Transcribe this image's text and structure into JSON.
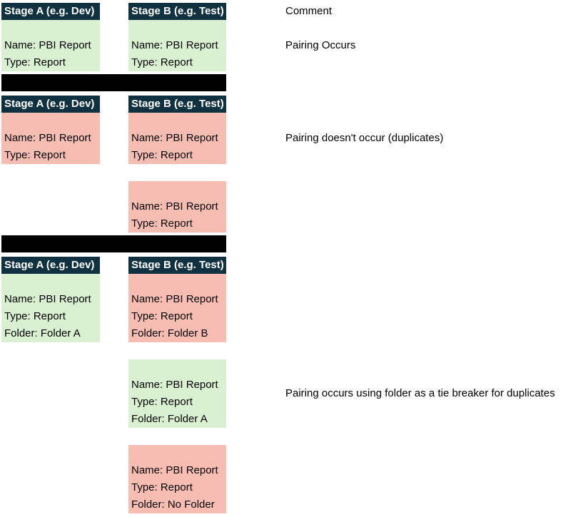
{
  "comment_header": "Comment",
  "colors": {
    "header_bg": "#0f3140",
    "paired": "#d9f1d0",
    "unpaired": "#f8bdb2",
    "separator": "#000000"
  },
  "scenarios": [
    {
      "stage_a_header": "Stage A (e.g. Dev)",
      "stage_b_header": "Stage B (e.g. Test)",
      "stage_a_items": [
        {
          "status": "paired",
          "lines": [
            "Name: PBI Report",
            "Type: Report"
          ]
        }
      ],
      "stage_b_items": [
        {
          "status": "paired",
          "lines": [
            "Name: PBI Report",
            "Type: Report"
          ]
        }
      ],
      "comment": "Pairing Occurs"
    },
    {
      "stage_a_header": "Stage A (e.g. Dev)",
      "stage_b_header": "Stage B (e.g. Test)",
      "stage_a_items": [
        {
          "status": "unpaired",
          "lines": [
            "Name: PBI Report",
            "Type: Report"
          ]
        }
      ],
      "stage_b_items": [
        {
          "status": "unpaired",
          "lines": [
            "Name: PBI Report",
            "Type: Report"
          ]
        },
        {
          "status": "unpaired",
          "lines": [
            "Name: PBI Report",
            "Type: Report"
          ]
        }
      ],
      "comment": "Pairing doesn't occur (duplicates)"
    },
    {
      "stage_a_header": "Stage A (e.g. Dev)",
      "stage_b_header": "Stage B (e.g. Test)",
      "stage_a_items": [
        {
          "status": "paired",
          "lines": [
            "Name: PBI Report",
            "Type: Report",
            "Folder: Folder A"
          ]
        }
      ],
      "stage_b_items": [
        {
          "status": "unpaired",
          "lines": [
            "Name: PBI Report",
            "Type: Report",
            "Folder: Folder B"
          ]
        },
        {
          "status": "paired",
          "lines": [
            "Name: PBI Report",
            "Type: Report",
            "Folder: Folder A"
          ]
        },
        {
          "status": "unpaired",
          "lines": [
            "Name: PBI Report",
            "Type: Report",
            "Folder: No Folder"
          ]
        }
      ],
      "comment": "Pairing occurs using folder as a tie breaker for duplicates"
    }
  ]
}
